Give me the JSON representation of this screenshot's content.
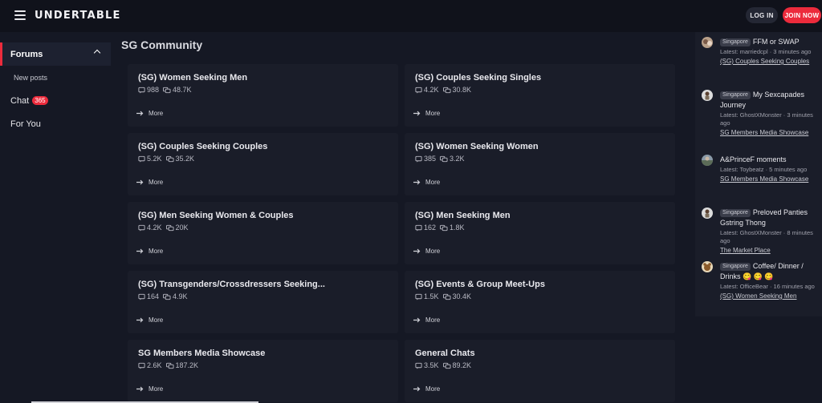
{
  "app": {
    "logo": "UNDERTABLE",
    "login_label": "LOG IN",
    "join_label": "JOIN NOW"
  },
  "sidebar": {
    "forums_label": "Forums",
    "new_posts_label": "New posts",
    "chat_label": "Chat",
    "chat_badge": "365",
    "for_you_label": "For You"
  },
  "main": {
    "section_title": "SG Community",
    "more_label": "More",
    "forums": [
      {
        "title": "(SG) Women Seeking Men",
        "threads": "988",
        "posts": "48.7K"
      },
      {
        "title": "(SG) Couples Seeking Singles",
        "threads": "4.2K",
        "posts": "30.8K"
      },
      {
        "title": "(SG) Couples Seeking Couples",
        "threads": "5.2K",
        "posts": "35.2K"
      },
      {
        "title": "(SG) Women Seeking Women",
        "threads": "385",
        "posts": "3.2K"
      },
      {
        "title": "(SG) Men Seeking Women & Couples",
        "threads": "4.2K",
        "posts": "20K"
      },
      {
        "title": "(SG) Men Seeking Men",
        "threads": "162",
        "posts": "1.8K"
      },
      {
        "title": "(SG) Transgenders/Crossdressers Seeking...",
        "threads": "164",
        "posts": "4.9K"
      },
      {
        "title": "(SG) Events & Group Meet-Ups",
        "threads": "1.5K",
        "posts": "30.4K"
      },
      {
        "title": "SG Members Media Showcase",
        "threads": "2.6K",
        "posts": "187.2K"
      },
      {
        "title": "General Chats",
        "threads": "3.5K",
        "posts": "89.2K"
      }
    ]
  },
  "latest": {
    "posts": [
      {
        "tag": "Singapore",
        "title": "FFM or SWAP",
        "meta": "Latest: marriedcpl · 3 minutes ago",
        "forum": "(SG) Couples Seeking Couples"
      },
      {
        "tag": "Singapore",
        "title": "My Sexcapades Journey",
        "meta": "Latest: GhostXMonster · 3 minutes ago",
        "forum": "SG Members Media Showcase"
      },
      {
        "tag": "",
        "title": "A&PrinceF moments",
        "meta": "Latest: Toybeatz · 5 minutes ago",
        "forum": "SG Members Media Showcase"
      },
      {
        "tag": "Singapore",
        "title": "Preloved Panties Gstring Thong",
        "meta": "Latest: GhostXMonster · 8 minutes ago",
        "forum": "The Market Place"
      },
      {
        "tag": "Singapore",
        "title": "Coffee/ Dinner / Drinks 😋 😋 😋",
        "meta": "Latest: OfficeBear · 16 minutes ago",
        "forum": "(SG) Women Seeking Men"
      }
    ]
  },
  "colors": {
    "accent": "#ec2b3c",
    "background": "#151824",
    "card": "#1a1d29"
  }
}
